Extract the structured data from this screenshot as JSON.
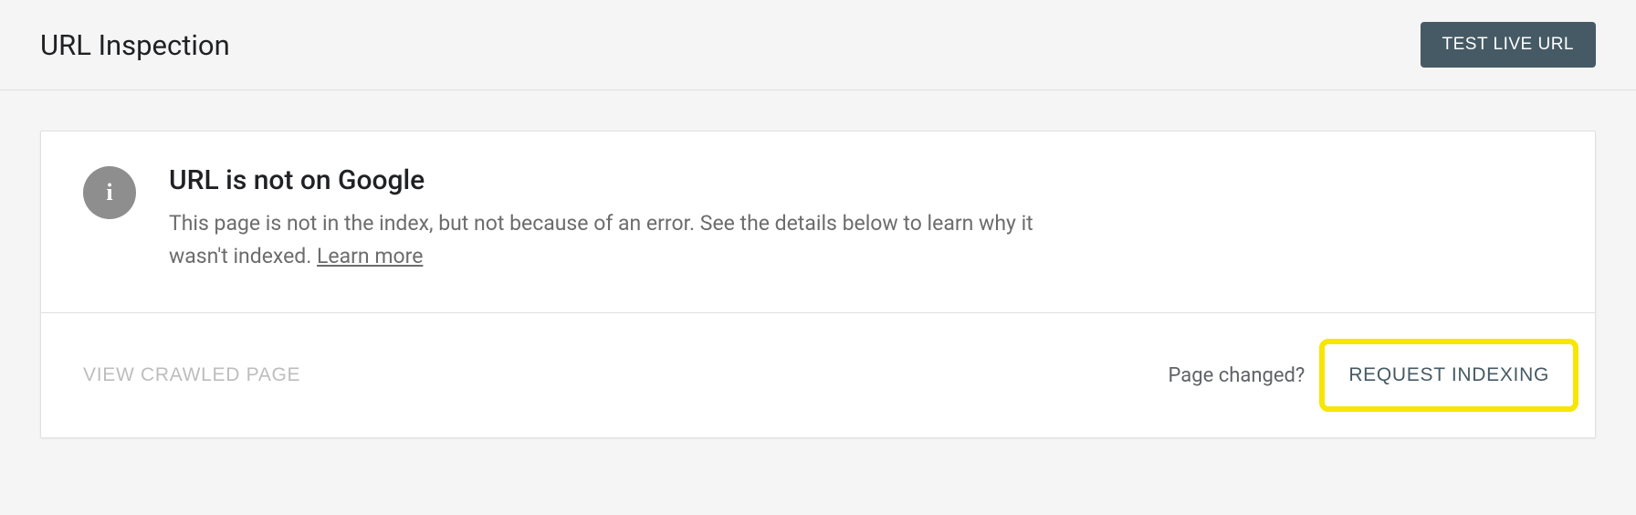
{
  "header": {
    "title": "URL Inspection",
    "test_live_url_label": "TEST LIVE URL"
  },
  "card": {
    "info_glyph": "i",
    "title": "URL is not on Google",
    "description_prefix": "This page is not in the index, but not because of an error. See the details below to learn why it wasn't indexed. ",
    "learn_more_label": "Learn more"
  },
  "footer": {
    "view_crawled_label": "VIEW CRAWLED PAGE",
    "page_changed_label": "Page changed?",
    "request_indexing_label": "REQUEST INDEXING"
  }
}
